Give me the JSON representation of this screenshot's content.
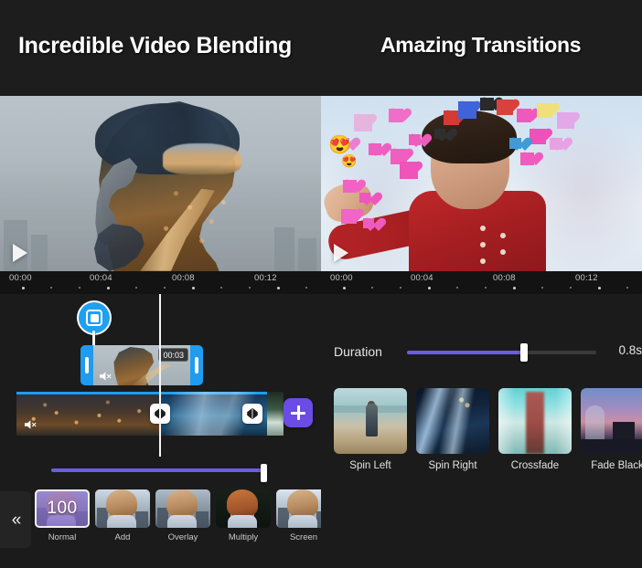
{
  "headings": {
    "left": "Incredible Video Blending",
    "right": "Amazing Transitions"
  },
  "previews": {
    "left": {
      "name": "double-exposure-portrait",
      "play_label": "play",
      "description": "Bearded man profile blended with night cityscape"
    },
    "right": {
      "name": "heart-emoji-video",
      "play_label": "play",
      "description": "Young man in red shirt with heart emoji stickers"
    }
  },
  "ruler": {
    "labels": [
      "00:00",
      "00:04",
      "00:08",
      "00:12"
    ],
    "label_positions": [
      12,
      140,
      268,
      396
    ]
  },
  "timeline": {
    "pin_icon": "pip-overlay-icon",
    "selected_clip": {
      "duration_badge": "00:03",
      "mute_icon": "mute-speaker-icon"
    },
    "track": {
      "mute_icon": "mute-speaker-icon",
      "transition_icon": "transition-bowtie-icon",
      "add_icon": "plus-icon"
    },
    "opacity_slider": {
      "value": 100
    },
    "collapse_icon": "chevron-double-left-icon"
  },
  "blend_modes": {
    "selected": "Normal",
    "selected_value": "100",
    "items": [
      {
        "label": "Normal"
      },
      {
        "label": "Add"
      },
      {
        "label": "Overlay"
      },
      {
        "label": "Multiply"
      },
      {
        "label": "Screen"
      }
    ]
  },
  "duration": {
    "label": "Duration",
    "value": "0.8s",
    "fill_percent": 62
  },
  "transitions": {
    "items": [
      {
        "label": "Spin Left"
      },
      {
        "label": "Spin Right"
      },
      {
        "label": "Crossfade"
      },
      {
        "label": "Fade Black"
      }
    ]
  },
  "colors": {
    "background": "#1b1b1b",
    "accent_purple": "#6b5ce7",
    "accent_blue": "#1f9cf0",
    "ruler_bg": "#131313",
    "text": "#ffffff"
  }
}
